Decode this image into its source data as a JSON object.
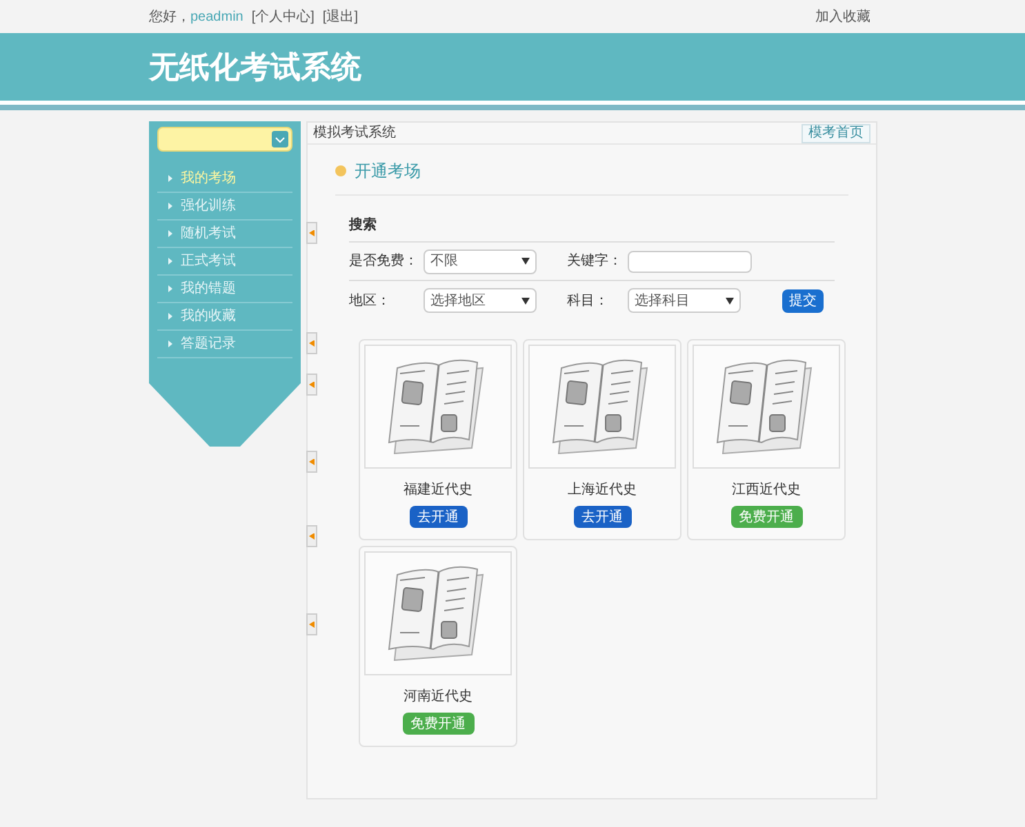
{
  "top_bar": {
    "greeting": "您好，",
    "username": "peadmin",
    "links": [
      "[个人中心]",
      "[退出]"
    ],
    "bookmark": "加入收藏"
  },
  "header": {
    "title": "无纸化考试系统"
  },
  "sidebar": {
    "items": [
      {
        "label": "我的考场",
        "selected": true
      },
      {
        "label": "强化训练",
        "selected": false
      },
      {
        "label": "随机考试",
        "selected": false
      },
      {
        "label": "正式考试",
        "selected": false
      },
      {
        "label": "我的错题",
        "selected": false
      },
      {
        "label": "我的收藏",
        "selected": false
      },
      {
        "label": "答题记录",
        "selected": false
      }
    ]
  },
  "breadcrumb": "模拟考试系统",
  "home_button": "模考首页",
  "section_title": "开通考场",
  "search": {
    "heading": "搜索",
    "free_label": "是否免费：",
    "free_value": "不限",
    "keyword_label": "关键字：",
    "region_label": "地区：",
    "region_value": "选择地区",
    "subject_label": "科目：",
    "subject_value": "选择科目",
    "submit": "提交"
  },
  "exams": [
    {
      "name": "福建近代史",
      "action": "去开通",
      "kind": "paid"
    },
    {
      "name": "上海近代史",
      "action": "去开通",
      "kind": "paid"
    },
    {
      "name": "江西近代史",
      "action": "免费开通",
      "kind": "free"
    },
    {
      "name": "河南近代史",
      "action": "免费开通",
      "kind": "free"
    }
  ]
}
